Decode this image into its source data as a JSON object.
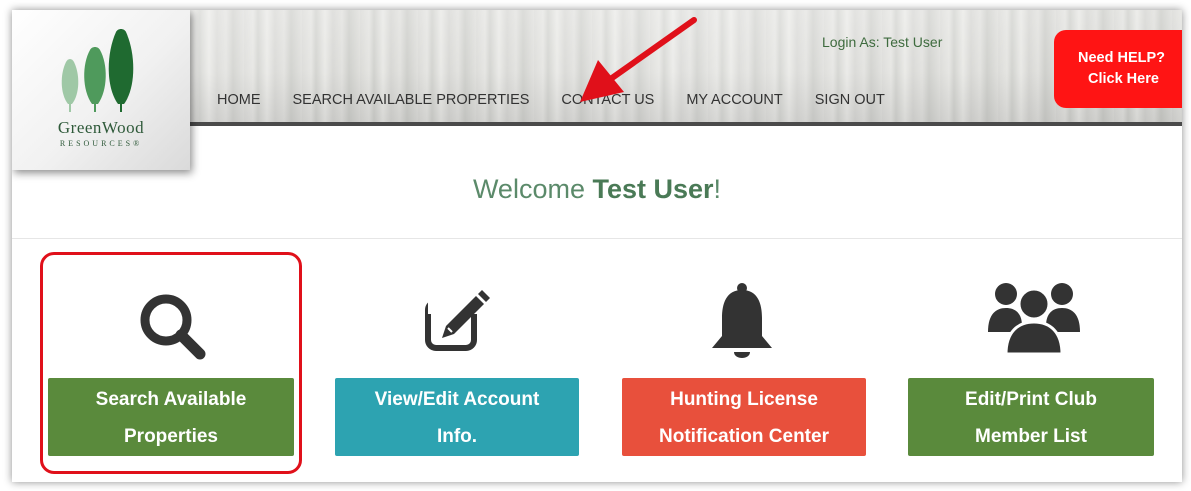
{
  "logo": {
    "name": "GreenWood",
    "sub": "RESOURCES®"
  },
  "header": {
    "login_as": "Login As: Test User",
    "help_line1": "Need HELP?",
    "help_line2": "Click Here"
  },
  "nav": {
    "items": [
      "HOME",
      "SEARCH AVAILABLE PROPERTIES",
      "CONTACT US",
      "MY ACCOUNT",
      "SIGN OUT"
    ]
  },
  "welcome": {
    "prefix": "Welcome ",
    "name": "Test User",
    "suffix": "!"
  },
  "tiles": [
    {
      "icon": "search-icon",
      "line1": "Search Available",
      "line2": "Properties",
      "color": "#5a8a3c"
    },
    {
      "icon": "edit-icon",
      "line1": "View/Edit Account",
      "line2": "Info.",
      "color": "#2da3b1"
    },
    {
      "icon": "bell-icon",
      "line1": "Hunting License",
      "line2": "Notification Center",
      "color": "#e8503c"
    },
    {
      "icon": "users-icon",
      "line1": "Edit/Print Club",
      "line2": "Member List",
      "color": "#5a8a3c"
    }
  ],
  "colors": {
    "brand_green": "#4a7a56",
    "help_red": "#ff1414",
    "nav_bar": "#4a4a4a",
    "annotation_red": "#e0101a"
  }
}
